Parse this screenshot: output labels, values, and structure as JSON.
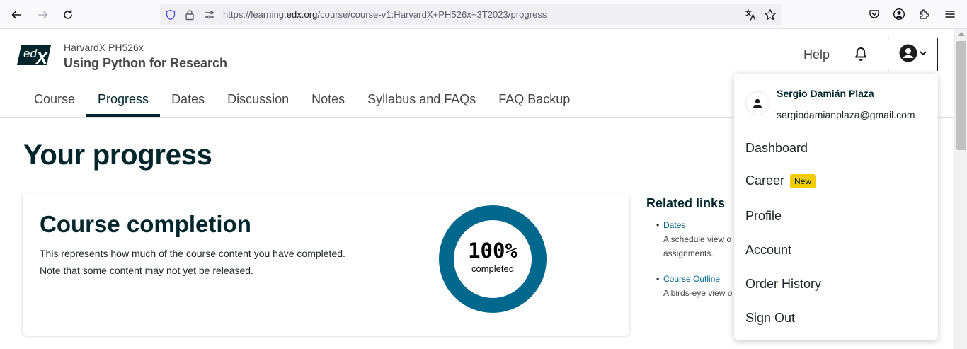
{
  "browser": {
    "url_prefix": "https://learning.",
    "url_domain": "edx.org",
    "url_path": "/course/course-v1:HarvardX+PH526x+3T2023/progress"
  },
  "header": {
    "logo_text": "edX",
    "course_org": "HarvardX PH526x",
    "course_title": "Using Python for Research",
    "help_label": "Help"
  },
  "tabs": [
    {
      "label": "Course"
    },
    {
      "label": "Progress",
      "active": true
    },
    {
      "label": "Dates"
    },
    {
      "label": "Discussion"
    },
    {
      "label": "Notes"
    },
    {
      "label": "Syllabus and FAQs"
    },
    {
      "label": "FAQ Backup"
    }
  ],
  "page": {
    "title": "Your progress"
  },
  "completion": {
    "title": "Course completion",
    "desc_line1": "This represents how much of the course content you have completed.",
    "desc_line2": "Note that some content may not yet be released.",
    "percent_label": "100%",
    "percent_value": 100,
    "completed_label": "completed",
    "ring_color": "#00688d"
  },
  "related": {
    "title": "Related links",
    "items": [
      {
        "link": "Dates",
        "desc": "A schedule view o",
        "desc2": "assignments."
      },
      {
        "link": "Course Outline",
        "desc": "A birds-eye view o",
        "desc2": ""
      }
    ]
  },
  "user_menu": {
    "name": "Sergio Damián Plaza",
    "email": "sergiodamianplaza@gmail.com",
    "items": [
      {
        "label": "Dashboard"
      },
      {
        "label": "Career",
        "badge": "New"
      },
      {
        "label": "Profile"
      },
      {
        "label": "Account"
      },
      {
        "label": "Order History"
      },
      {
        "label": "Sign Out"
      }
    ]
  },
  "colors": {
    "brand_dark": "#00262b",
    "link": "#00688d",
    "badge": "#f0cc00"
  }
}
